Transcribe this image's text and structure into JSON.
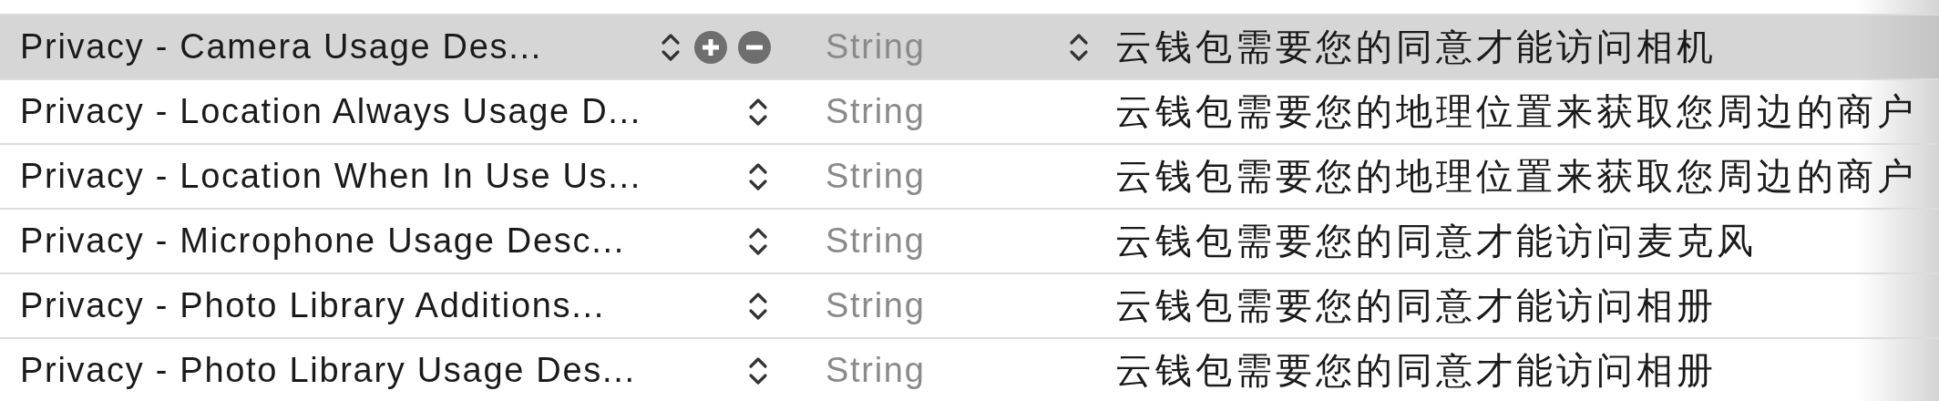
{
  "rows": [
    {
      "key": "Privacy - Camera Usage Des...",
      "type": "String",
      "value": "云钱包需要您的同意才能访问相机",
      "selected": true
    },
    {
      "key": "Privacy - Location Always Usage D...",
      "type": "String",
      "value": "云钱包需要您的地理位置来获取您周边的商户",
      "selected": false
    },
    {
      "key": "Privacy - Location When In Use Us...",
      "type": "String",
      "value": "云钱包需要您的地理位置来获取您周边的商户",
      "selected": false
    },
    {
      "key": "Privacy - Microphone Usage Desc...",
      "type": "String",
      "value": "云钱包需要您的同意才能访问麦克风",
      "selected": false
    },
    {
      "key": "Privacy - Photo Library Additions...",
      "type": "String",
      "value": "云钱包需要您的同意才能访问相册",
      "selected": false
    },
    {
      "key": "Privacy - Photo Library Usage Des...",
      "type": "String",
      "value": "云钱包需要您的同意才能访问相册",
      "selected": false
    }
  ]
}
